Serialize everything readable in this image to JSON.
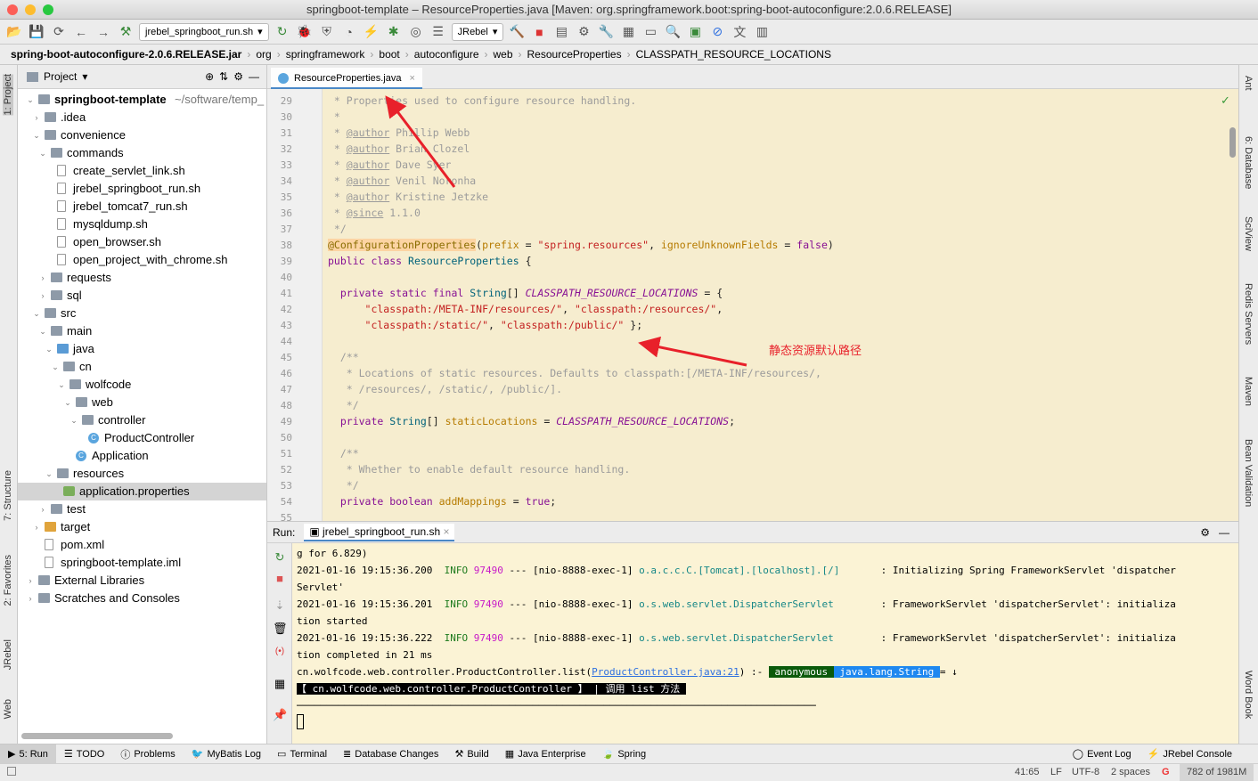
{
  "window": {
    "title": "springboot-template – ResourceProperties.java [Maven: org.springframework.boot:spring-boot-autoconfigure:2.0.6.RELEASE]"
  },
  "toolbar": {
    "run_config": "jrebel_springboot_run.sh",
    "jrebel_combo": "JRebel"
  },
  "breadcrumb": [
    "spring-boot-autoconfigure-2.0.6.RELEASE.jar",
    "org",
    "springframework",
    "boot",
    "autoconfigure",
    "web",
    "ResourceProperties",
    "CLASSPATH_RESOURCE_LOCATIONS"
  ],
  "left_strip": [
    "1: Project",
    "7: Structure",
    "2: Favorites",
    "JRebel",
    "Web"
  ],
  "right_strip": [
    "Ant",
    "6: Database",
    "SciView",
    "Redis Servers",
    "Maven",
    "Bean Validation",
    "Word Book"
  ],
  "project": {
    "header": "Project",
    "tree": [
      {
        "label": "springboot-template",
        "extra": "~/software/temp_",
        "depth": 0,
        "kind": "folder",
        "open": true,
        "bold": true
      },
      {
        "label": ".idea",
        "depth": 1,
        "kind": "folder",
        "open": false
      },
      {
        "label": "convenience",
        "depth": 1,
        "kind": "folder",
        "open": true
      },
      {
        "label": "commands",
        "depth": 2,
        "kind": "folder",
        "open": true
      },
      {
        "label": "create_servlet_link.sh",
        "depth": 3,
        "kind": "file"
      },
      {
        "label": "jrebel_springboot_run.sh",
        "depth": 3,
        "kind": "file"
      },
      {
        "label": "jrebel_tomcat7_run.sh",
        "depth": 3,
        "kind": "file"
      },
      {
        "label": "mysqldump.sh",
        "depth": 3,
        "kind": "file"
      },
      {
        "label": "open_browser.sh",
        "depth": 3,
        "kind": "file"
      },
      {
        "label": "open_project_with_chrome.sh",
        "depth": 3,
        "kind": "file"
      },
      {
        "label": "requests",
        "depth": 2,
        "kind": "folder",
        "open": false
      },
      {
        "label": "sql",
        "depth": 2,
        "kind": "folder",
        "open": false
      },
      {
        "label": "src",
        "depth": 1,
        "kind": "folder",
        "open": true
      },
      {
        "label": "main",
        "depth": 2,
        "kind": "folder",
        "open": true
      },
      {
        "label": "java",
        "depth": 3,
        "kind": "folder blue",
        "open": true
      },
      {
        "label": "cn",
        "depth": 4,
        "kind": "folder",
        "open": true
      },
      {
        "label": "wolfcode",
        "depth": 5,
        "kind": "folder",
        "open": true
      },
      {
        "label": "web",
        "depth": 6,
        "kind": "folder",
        "open": true
      },
      {
        "label": "controller",
        "depth": 7,
        "kind": "folder",
        "open": true
      },
      {
        "label": "ProductController",
        "depth": 8,
        "kind": "cls"
      },
      {
        "label": "Application",
        "depth": 6,
        "kind": "cls"
      },
      {
        "label": "resources",
        "depth": 3,
        "kind": "folder",
        "open": true
      },
      {
        "label": "application.properties",
        "depth": 4,
        "kind": "props",
        "selected": true
      },
      {
        "label": "test",
        "depth": 2,
        "kind": "folder",
        "open": false
      },
      {
        "label": "target",
        "depth": 1,
        "kind": "folder orange",
        "open": false
      },
      {
        "label": "pom.xml",
        "depth": 1,
        "kind": "file"
      },
      {
        "label": "springboot-template.iml",
        "depth": 1,
        "kind": "file"
      },
      {
        "label": "External Libraries",
        "depth": 0,
        "kind": "lib",
        "open": false
      },
      {
        "label": "Scratches and Consoles",
        "depth": 0,
        "kind": "lib",
        "open": false
      }
    ]
  },
  "editor": {
    "tab": "ResourceProperties.java",
    "first_line": 29,
    "lines": [
      [
        [
          " * Properties used to configure resource handling.",
          "c"
        ]
      ],
      [
        [
          " *",
          "c"
        ]
      ],
      [
        [
          " * ",
          "c"
        ],
        [
          "@author",
          "tag"
        ],
        [
          " Phillip Webb",
          "c"
        ]
      ],
      [
        [
          " * ",
          "c"
        ],
        [
          "@author",
          "tag"
        ],
        [
          " Brian Clozel",
          "c"
        ]
      ],
      [
        [
          " * ",
          "c"
        ],
        [
          "@author",
          "tag"
        ],
        [
          " Dave Syer",
          "c"
        ]
      ],
      [
        [
          " * ",
          "c"
        ],
        [
          "@author",
          "tag"
        ],
        [
          " Venil Noronha",
          "c"
        ]
      ],
      [
        [
          " * ",
          "c"
        ],
        [
          "@author",
          "tag"
        ],
        [
          " Kristine Jetzke",
          "c"
        ]
      ],
      [
        [
          " * ",
          "c"
        ],
        [
          "@since",
          "tag"
        ],
        [
          " 1.1.0",
          "c"
        ]
      ],
      [
        [
          " */",
          "c"
        ]
      ],
      [
        [
          "@ConfigurationProperties",
          "an"
        ],
        [
          "(",
          "no"
        ],
        [
          "prefix",
          "pr"
        ],
        [
          " = ",
          "no"
        ],
        [
          "\"spring.resources\"",
          "st"
        ],
        [
          ", ",
          "no"
        ],
        [
          "ignoreUnknownFields",
          "pr"
        ],
        [
          " = ",
          "no"
        ],
        [
          "false",
          "kw"
        ],
        [
          ")",
          "no"
        ]
      ],
      [
        [
          "public class ",
          "kw"
        ],
        [
          "ResourceProperties",
          "ty"
        ],
        [
          " {",
          "no"
        ]
      ],
      [
        [
          "",
          "no"
        ]
      ],
      [
        [
          "  private static final ",
          "kw"
        ],
        [
          "String",
          "ty"
        ],
        [
          "[] ",
          "no"
        ],
        [
          "CLASSPATH_RESOURCE_LOCATIONS",
          "cn"
        ],
        [
          " = {",
          "no"
        ]
      ],
      [
        [
          "      \"classpath:/META-INF/resources/\"",
          "st"
        ],
        [
          ", ",
          "no"
        ],
        [
          "\"classpath:/resources/\"",
          "st"
        ],
        [
          ",",
          "no"
        ]
      ],
      [
        [
          "      \"classpath:/static/\"",
          "st"
        ],
        [
          ", ",
          "no"
        ],
        [
          "\"classpath:/public/\"",
          "st"
        ],
        [
          " };",
          "no"
        ]
      ],
      [
        [
          "",
          "no"
        ]
      ],
      [
        [
          "  /**",
          "c"
        ]
      ],
      [
        [
          "   * Locations of static resources. Defaults to classpath:[/META-INF/resources/,",
          "c"
        ]
      ],
      [
        [
          "   * /resources/, /static/, /public/].",
          "c"
        ]
      ],
      [
        [
          "   */",
          "c"
        ]
      ],
      [
        [
          "  private ",
          "kw"
        ],
        [
          "String",
          "ty"
        ],
        [
          "[] ",
          "no"
        ],
        [
          "staticLocations",
          "pr"
        ],
        [
          " = ",
          "no"
        ],
        [
          "CLASSPATH_RESOURCE_LOCATIONS",
          "cn"
        ],
        [
          ";",
          "no"
        ]
      ],
      [
        [
          "",
          "no"
        ]
      ],
      [
        [
          "  /**",
          "c"
        ]
      ],
      [
        [
          "   * Whether to enable default resource handling.",
          "c"
        ]
      ],
      [
        [
          "   */",
          "c"
        ]
      ],
      [
        [
          "  private boolean ",
          "kw"
        ],
        [
          "addMappings",
          "pr"
        ],
        [
          " = ",
          "no"
        ],
        [
          "true",
          "kw"
        ],
        [
          ";",
          "no"
        ]
      ],
      [
        [
          "",
          "no"
        ]
      ]
    ],
    "annotation": "静态资源默认路径"
  },
  "run": {
    "label": "Run:",
    "tab": "jrebel_springboot_run.sh",
    "console": [
      [
        [
          "g for 6.829)",
          ""
        ]
      ],
      [
        [
          "2021-01-16 19:15:36.200  ",
          ""
        ],
        [
          "INFO ",
          "g"
        ],
        [
          "97490",
          "m"
        ],
        [
          " --- [nio-8888-exec-1] ",
          ""
        ],
        [
          "o.a.c.c.C.[Tomcat].[localhost].[/]",
          "t"
        ],
        [
          "       : Initializing Spring FrameworkServlet 'dispatcher",
          ""
        ]
      ],
      [
        [
          "Servlet'",
          ""
        ]
      ],
      [
        [
          "2021-01-16 19:15:36.201  ",
          ""
        ],
        [
          "INFO ",
          "g"
        ],
        [
          "97490",
          "m"
        ],
        [
          " --- [nio-8888-exec-1] ",
          ""
        ],
        [
          "o.s.web.servlet.DispatcherServlet",
          "t"
        ],
        [
          "        : FrameworkServlet 'dispatcherServlet': initializa",
          ""
        ]
      ],
      [
        [
          "tion started",
          ""
        ]
      ],
      [
        [
          "2021-01-16 19:15:36.222  ",
          ""
        ],
        [
          "INFO ",
          "g"
        ],
        [
          "97490",
          "m"
        ],
        [
          " --- [nio-8888-exec-1] ",
          ""
        ],
        [
          "o.s.web.servlet.DispatcherServlet",
          "t"
        ],
        [
          "        : FrameworkServlet 'dispatcherServlet': initializa",
          ""
        ]
      ],
      [
        [
          "tion completed in 21 ms",
          ""
        ]
      ],
      [
        [
          "cn.wolfcode.web.controller.ProductController.list(",
          ""
        ],
        [
          "ProductController.java:21",
          "lk"
        ],
        [
          ") :- ",
          ""
        ],
        [
          " anonymous ",
          "hlg"
        ],
        [
          " java.lang.String ",
          "hlb"
        ],
        [
          "= ↓",
          ""
        ]
      ],
      [
        [
          "【 cn.wolfcode.web.controller.ProductController 】 | 调用 list 方法 ",
          "hlk"
        ]
      ],
      [
        [
          "────────────────────────────────────────────────────────────────────────────────────────",
          ""
        ]
      ]
    ]
  },
  "bottom_tools": [
    "5: Run",
    "TODO",
    "Problems",
    "MyBatis Log",
    "Terminal",
    "Database Changes",
    "Build",
    "Java Enterprise",
    "Spring"
  ],
  "bottom_right": [
    "Event Log",
    "JRebel Console"
  ],
  "status": {
    "position": "41:65",
    "line_sep": "LF",
    "encoding": "UTF-8",
    "indent": "2 spaces",
    "memory": "782 of 1981M"
  },
  "colors": {
    "editor_bg": "#f6edcf",
    "console_bg": "#fbf3d5",
    "annotation": "#e8202a"
  }
}
